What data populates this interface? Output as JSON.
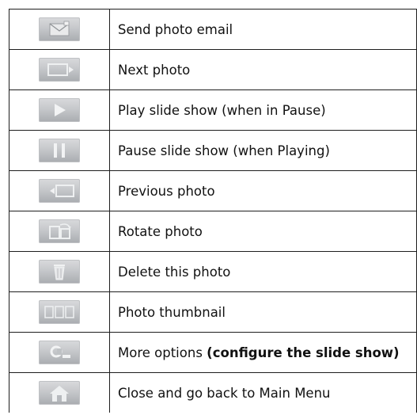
{
  "rows": [
    {
      "icon": "email-photo-icon",
      "label": "Send photo email",
      "label_bold": ""
    },
    {
      "icon": "next-photo-icon",
      "label": "Next photo",
      "label_bold": ""
    },
    {
      "icon": "play-icon",
      "label": "Play slide show (when in Pause)",
      "label_bold": ""
    },
    {
      "icon": "pause-icon",
      "label": "Pause slide show (when Playing)",
      "label_bold": ""
    },
    {
      "icon": "previous-photo-icon",
      "label": "Previous photo",
      "label_bold": ""
    },
    {
      "icon": "rotate-photo-icon",
      "label": "Rotate photo",
      "label_bold": ""
    },
    {
      "icon": "delete-photo-icon",
      "label": "Delete this photo",
      "label_bold": ""
    },
    {
      "icon": "thumbnail-icon",
      "label": "Photo thumbnail",
      "label_bold": ""
    },
    {
      "icon": "more-options-icon",
      "label": "More options ",
      "label_bold": "(configure the slide show)"
    },
    {
      "icon": "home-icon",
      "label": "Close and go back to Main Menu",
      "label_bold": ""
    }
  ]
}
